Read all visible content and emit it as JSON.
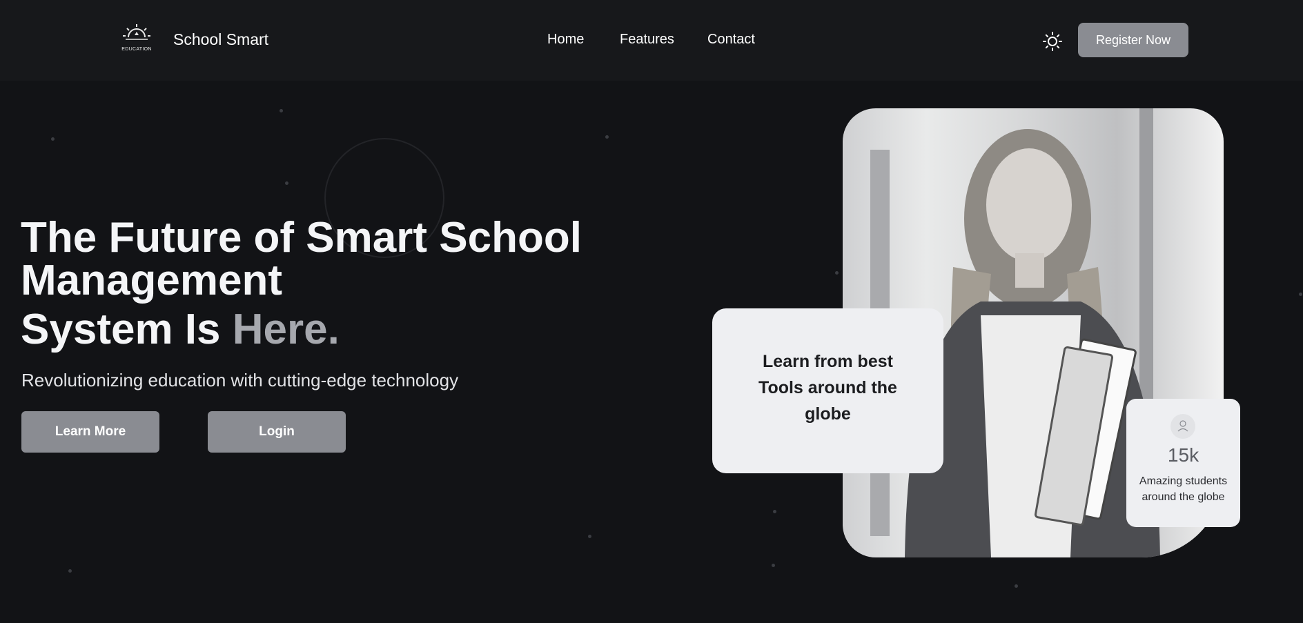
{
  "header": {
    "logo_caption": "EDUCATION",
    "brand": "School Smart",
    "nav": [
      {
        "label": "Home"
      },
      {
        "label": "Features"
      },
      {
        "label": "Contact"
      }
    ],
    "register_label": "Register Now",
    "theme_icon": "sun-icon"
  },
  "hero": {
    "title_line1": "The Future of Smart School",
    "title_line2": "Management",
    "title_line3_start": "System Is ",
    "title_line3_accent": "Here.",
    "subtitle": "Revolutionizing education with cutting-edge technology",
    "buttons": [
      {
        "label": "Learn More"
      },
      {
        "label": "Login"
      }
    ]
  },
  "cards": {
    "feature_text": "Learn from best Tools around the globe",
    "stat_icon": "user-icon",
    "stat_value": "15k",
    "stat_label": "Amazing students around the globe"
  },
  "colors": {
    "background": "#121316",
    "header": "#17181b",
    "button": "#8a8c92",
    "accent_text": "#a6a8ae",
    "card": "#eeeff2"
  }
}
